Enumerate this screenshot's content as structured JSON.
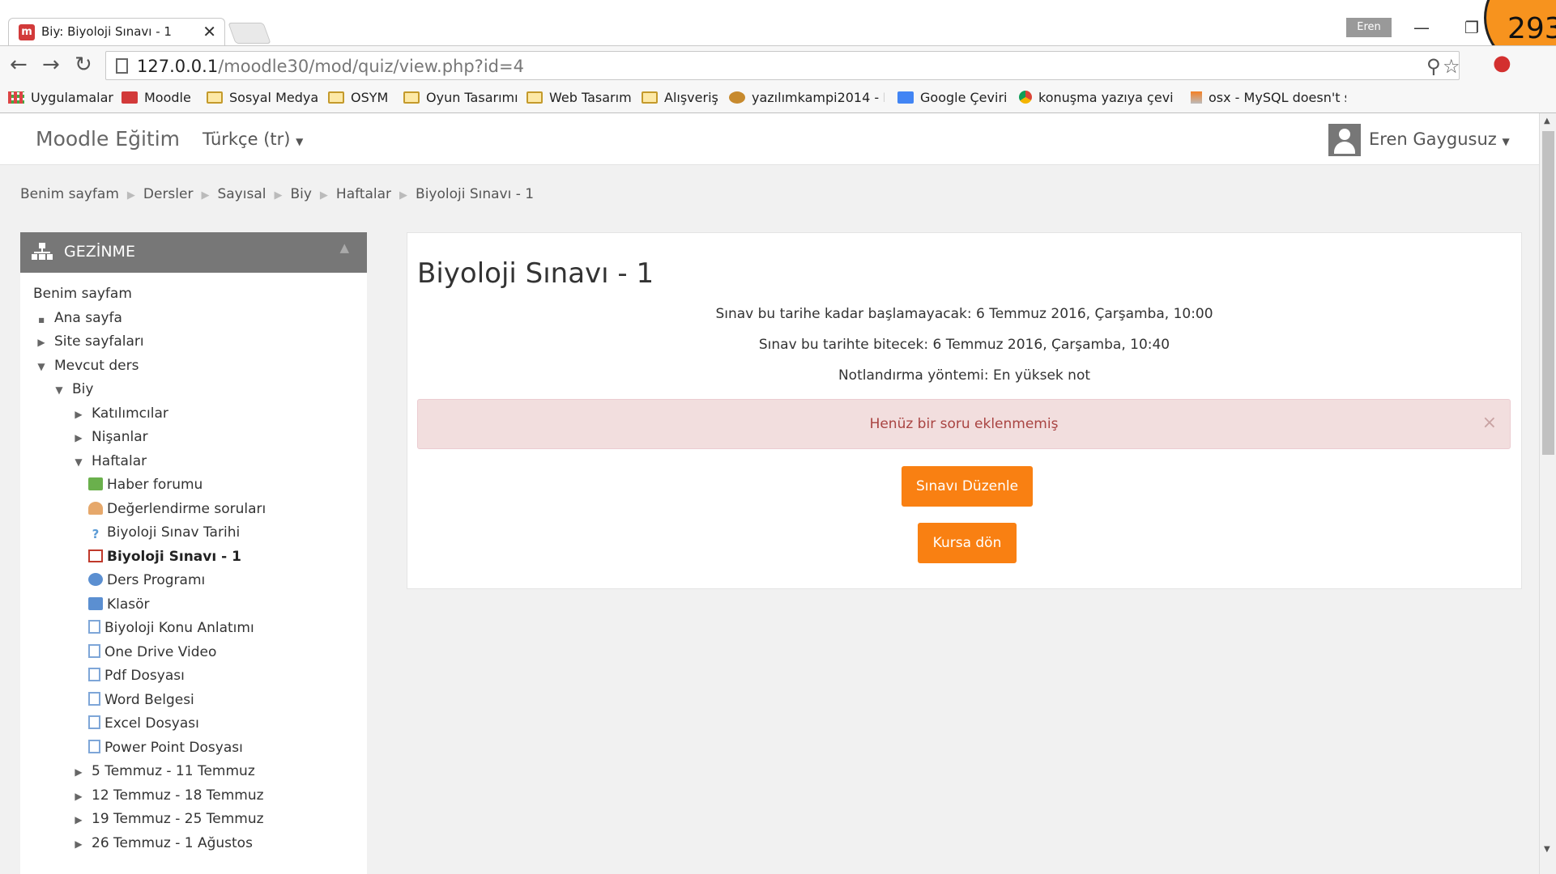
{
  "browser": {
    "tab_title": "Biy: Biyoloji Sınavı - 1",
    "tab_favicon": "m",
    "tab_close": "✕",
    "profile_name": "Eren",
    "corner_badge": "293",
    "url_host": "127.0.0.1",
    "url_path": "/moodle30/mod/quiz/view.php?id=4",
    "bookmarks": [
      {
        "label": "Uygulamalar",
        "icon": "apps-icon"
      },
      {
        "label": "Moodle",
        "icon": "moodle-icon"
      },
      {
        "label": "Sosyal Medya",
        "icon": "folder-icon"
      },
      {
        "label": "OSYM",
        "icon": "folder-icon"
      },
      {
        "label": "Oyun Tasarımı",
        "icon": "folder-icon"
      },
      {
        "label": "Web Tasarım",
        "icon": "folder-icon"
      },
      {
        "label": "Alışveriş",
        "icon": "folder-icon"
      },
      {
        "label": "yazılımkampi2014 - Pı",
        "icon": "site-icon"
      },
      {
        "label": "Google Çeviri",
        "icon": "google-translate-icon"
      },
      {
        "label": "konuşma yazıya çevir",
        "icon": "chrome-icon"
      },
      {
        "label": "osx - MySQL doesn't s",
        "icon": "stackoverflow-icon"
      }
    ]
  },
  "navbar": {
    "brand": "Moodle Eğitim",
    "language": "Türkçe (tr)",
    "user_name": "Eren Gaygusuz"
  },
  "breadcrumb": [
    "Benim sayfam",
    "Dersler",
    "Sayısal",
    "Biy",
    "Haftalar",
    "Biyoloji Sınavı - 1"
  ],
  "navigation_block": {
    "title": "GEZİNME",
    "items": [
      {
        "label": "Benim sayfam",
        "level": 0,
        "marker": ""
      },
      {
        "label": "Ana sayfa",
        "level": 0,
        "marker": "bullet"
      },
      {
        "label": "Site sayfaları",
        "level": 0,
        "marker": "collapsed"
      },
      {
        "label": "Mevcut ders",
        "level": 0,
        "marker": "expanded"
      },
      {
        "label": "Biy",
        "level": 1,
        "marker": "expanded"
      },
      {
        "label": "Katılımcılar",
        "level": 2,
        "marker": "collapsed"
      },
      {
        "label": "Nişanlar",
        "level": 2,
        "marker": "collapsed"
      },
      {
        "label": "Haftalar",
        "level": 2,
        "marker": "expanded"
      },
      {
        "label": "Haber forumu",
        "level": 3,
        "marker": "forum"
      },
      {
        "label": "Değerlendirme soruları",
        "level": 3,
        "marker": "feedback"
      },
      {
        "label": "Biyoloji Sınav Tarihi",
        "level": 3,
        "marker": "question"
      },
      {
        "label": "Biyoloji Sınavı - 1",
        "level": 3,
        "marker": "quiz"
      },
      {
        "label": "Ders Programı",
        "level": 3,
        "marker": "schedule"
      },
      {
        "label": "Klasör",
        "level": 3,
        "marker": "folder"
      },
      {
        "label": "Biyoloji Konu Anlatımı",
        "level": 3,
        "marker": "page"
      },
      {
        "label": "One Drive Video",
        "level": 3,
        "marker": "page"
      },
      {
        "label": "Pdf Dosyası",
        "level": 3,
        "marker": "page"
      },
      {
        "label": "Word Belgesi",
        "level": 3,
        "marker": "page"
      },
      {
        "label": "Excel Dosyası",
        "level": 3,
        "marker": "page"
      },
      {
        "label": "Power Point Dosyası",
        "level": 3,
        "marker": "page"
      },
      {
        "label": "5 Temmuz - 11 Temmuz",
        "level": 2,
        "marker": "collapsed"
      },
      {
        "label": "12 Temmuz - 18 Temmuz",
        "level": 2,
        "marker": "collapsed"
      },
      {
        "label": "19 Temmuz - 25 Temmuz",
        "level": 2,
        "marker": "collapsed"
      },
      {
        "label": "26 Temmuz - 1 Ağustos",
        "level": 2,
        "marker": "collapsed"
      }
    ]
  },
  "quiz": {
    "title": "Biyoloji Sınavı - 1",
    "open_info": "Sınav bu tarihe kadar başlamayacak: 6 Temmuz 2016, Çarşamba, 10:00",
    "close_info": "Sınav bu tarihte bitecek: 6 Temmuz 2016, Çarşamba, 10:40",
    "grading_info": "Notlandırma yöntemi: En yüksek not",
    "alert": "Henüz bir soru eklenmemiş",
    "edit_button": "Sınavı Düzenle",
    "back_button": "Kursa dön"
  },
  "colors": {
    "accent": "#f98012",
    "alert_bg": "#f2dede",
    "alert_text": "#a94442",
    "block_header": "#777777"
  }
}
